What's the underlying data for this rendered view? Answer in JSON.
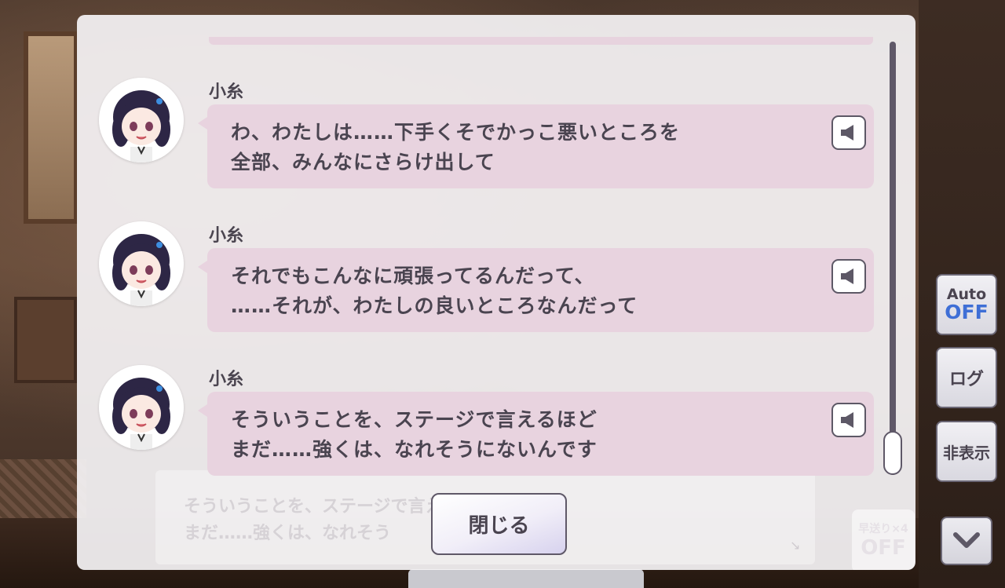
{
  "history": [
    {
      "speaker": "小糸",
      "lines": [
        "わ、わたしは……下手くそでかっこ悪いところを",
        "全部、みんなにさらけ出して"
      ],
      "voice_icon": "speaker-icon"
    },
    {
      "speaker": "小糸",
      "lines": [
        "それでもこんなに頑張ってるんだって、",
        "……それが、わたしの良いところなんだって"
      ],
      "voice_icon": "speaker-icon"
    },
    {
      "speaker": "小糸",
      "lines": [
        "そういうことを、ステージで言えるほど",
        "まだ……強くは、なれそうにないんです"
      ],
      "voice_icon": "speaker-icon"
    }
  ],
  "background_dialog": {
    "lines": [
      "そういうことを、ステージで言えるほど",
      "まだ……強くは、なれそう"
    ]
  },
  "close_label": "閉じる",
  "side": {
    "auto_label": "Auto",
    "auto_state": "OFF",
    "log_label": "ログ",
    "hide_label": "非表示",
    "fast_forward_label": "早送り×4",
    "fast_forward_state": "OFF",
    "menu_icon": "chevron-down-icon"
  },
  "colors": {
    "bubble": "#e8d3df",
    "text": "#4a4450",
    "auto_off": "#3f6fd6"
  }
}
